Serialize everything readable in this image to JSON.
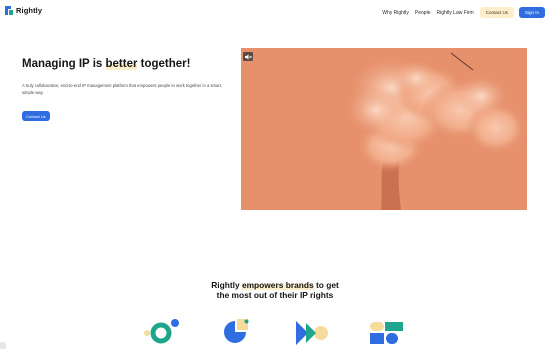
{
  "brand": {
    "name": "Rightly"
  },
  "nav": {
    "links": [
      "Why Rightly",
      "People",
      "Rightly Law Firm"
    ],
    "contact_label": "Contact Us",
    "signin_label": "Sign In"
  },
  "hero": {
    "title_before": "Managing IP is ",
    "title_highlight": "better",
    "title_after": " together!",
    "subtitle": "A truly collaborative, end-to-end IP management platform that empowers people to work together in a smart, simple way.",
    "cta_label": "Contact Us"
  },
  "section": {
    "line1_before": "Rightly ",
    "line1_highlight": "empowers brands",
    "line1_after": " to get",
    "line2": "the most out of their IP rights"
  },
  "colors": {
    "brand_blue": "#2f6de1",
    "highlight_cream": "#fdeecb",
    "hero_orange": "#e6916c",
    "icon_green": "#1ea58c",
    "icon_yellow": "#f6dc9b"
  },
  "icons": [
    "circle-cluster-icon",
    "pie-shape-icon",
    "play-arrows-icon",
    "tile-blocks-icon",
    "video-mute-icon",
    "chat-launcher-icon"
  ]
}
